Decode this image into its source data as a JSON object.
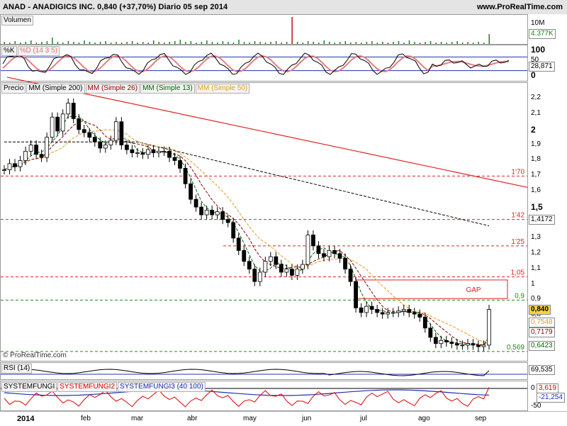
{
  "header": {
    "symbol": "ANAD",
    "company": "ANADIGICS INC.",
    "price": "0,840",
    "change": "(+37,70%)",
    "period": "Diario",
    "date": "05 sep 2014",
    "title_text": "ANAD - ANADIGICS INC.    0,840 (+37,70%)   Diario  05 sep 2014",
    "site": "www.ProRealTime.com"
  },
  "watermark": "© ProRealTime.com",
  "colors": {
    "up_candle": "#ffffff",
    "down_candle": "#000000",
    "ma200": "#000000",
    "ma26": "#8b0000",
    "ma13": "#006400",
    "ma50": "#e69a1e",
    "trendline": "#e02020",
    "level_lines": "#e02020",
    "support_line": "#1a8c1a",
    "stoch_k": "#000000",
    "stoch_d": "#e08080",
    "rsi": "#000000",
    "fungi1": "#000000",
    "fungi2": "#e00000",
    "fungi3": "#2030b0",
    "volume": "#208020",
    "gap_box": "#e02020"
  },
  "volume_pane": {
    "label": "Volumen",
    "axis_max": "10M",
    "last_value": "4.377K"
  },
  "stoch_pane": {
    "labels": [
      "%K",
      "%D (14 3 5)"
    ],
    "axis": [
      "100",
      "50",
      "0"
    ],
    "last_value": "28,871"
  },
  "price_pane": {
    "labels": [
      "Precio",
      "MM (Simple 200)",
      "MM (Simple 26)",
      "MM (Simple 13)",
      "MM (Simple 50)"
    ],
    "axis_ticks": [
      "2,2",
      "2,1",
      "2",
      "1,9",
      "1,8",
      "1,7",
      "1,6",
      "1,5",
      "1,4",
      "1,3",
      "1,2",
      "1,1",
      "1",
      "0,9",
      "0,8",
      "0,7",
      "0,6"
    ],
    "value_boxes": [
      {
        "label": "1,4172",
        "color": "#000000"
      },
      {
        "label": "0,840",
        "color": "#000000",
        "fill": "#ffd040"
      },
      {
        "label": "0,7548",
        "color": "#e69a1e"
      },
      {
        "label": "0,7179",
        "color": "#8b0000"
      },
      {
        "label": "0,6423",
        "color": "#006400"
      }
    ],
    "levels": [
      {
        "label": "1'70",
        "value": 1.7
      },
      {
        "label": "1'42",
        "value": 1.42
      },
      {
        "label": "1'25",
        "value": 1.25
      },
      {
        "label": "1,05",
        "value": 1.05
      },
      {
        "label": "0,9",
        "value": 0.9
      },
      {
        "label": "0,569",
        "value": 0.569
      }
    ],
    "gap_label": "GAP"
  },
  "rsi_pane": {
    "label": "RSI (14)",
    "last_value": "69,535"
  },
  "fungi_pane": {
    "labels": [
      "SYSTEMFUNGI",
      "SYSTEMFUNGI2",
      "SYSTEMFUNGI3 (40 100)"
    ],
    "axis": [
      "0",
      "-50"
    ],
    "values": [
      "3,619",
      "-21,254"
    ]
  },
  "x_axis": {
    "year": "2014",
    "months": [
      "feb",
      "mar",
      "abr",
      "may",
      "jun",
      "jul",
      "ago",
      "sep"
    ]
  },
  "chart_data": {
    "type": "line",
    "title": "ANAD - ANADIGICS INC.",
    "ylim": [
      0.55,
      2.25
    ],
    "xlabels": [
      "2014",
      "feb",
      "mar",
      "abr",
      "may",
      "jun",
      "jul",
      "ago",
      "sep"
    ],
    "price_close": [
      1.74,
      1.78,
      1.76,
      1.8,
      1.86,
      1.9,
      1.84,
      1.82,
      1.95,
      2.08,
      1.99,
      2.1,
      2.17,
      2.07,
      2.0,
      1.98,
      1.95,
      1.92,
      1.88,
      1.9,
      1.93,
      2.05,
      1.9,
      1.87,
      1.85,
      1.85,
      1.84,
      1.87,
      1.85,
      1.86,
      1.86,
      1.82,
      1.8,
      1.75,
      1.65,
      1.55,
      1.5,
      1.45,
      1.48,
      1.45,
      1.47,
      1.42,
      1.4,
      1.3,
      1.22,
      1.15,
      1.1,
      1.02,
      1.08,
      1.15,
      1.18,
      1.13,
      1.08,
      1.1,
      1.06,
      1.1,
      1.13,
      1.32,
      1.25,
      1.2,
      1.18,
      1.22,
      1.2,
      1.17,
      1.1,
      1.02,
      0.85,
      0.82,
      0.86,
      0.84,
      0.82,
      0.81,
      0.82,
      0.82,
      0.83,
      0.84,
      0.82,
      0.81,
      0.79,
      0.72,
      0.66,
      0.62,
      0.64,
      0.63,
      0.62,
      0.61,
      0.61,
      0.62,
      0.61,
      0.6,
      0.61,
      0.84
    ],
    "series_levels": {
      "trendline_start": 2.2,
      "trendline_end": 1.65,
      "ma200_last": 1.4172,
      "ma50_last": 0.7548,
      "ma26_last": 0.7179,
      "ma13_last": 0.6423
    },
    "rsi_last": 69.535,
    "stoch_last": 28.871
  }
}
